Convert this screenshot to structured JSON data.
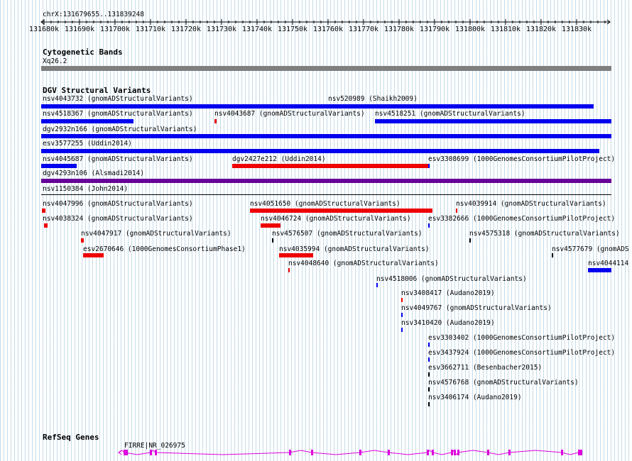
{
  "colors": {
    "blue": "#0000ee",
    "red": "#ee0000",
    "purple": "#660099",
    "gene": "#dd00dd",
    "band": "#7f7f7f"
  },
  "ruler": {
    "range_label": "chrX:131679655..131839248",
    "ticks": [
      "131680k",
      "131690k",
      "131700k",
      "131710k",
      "131720k",
      "131730k",
      "131740k",
      "131750k",
      "131760k",
      "131770k",
      "131780k",
      "131790k",
      "131800k",
      "131810k",
      "131820k",
      "131830k"
    ]
  },
  "tracks": {
    "cyto_title": "Cytogenetic Bands",
    "cyto_band": "Xq26.2",
    "dgv_title": "DGV Structural Variants",
    "refseq_title": "RefSeq Genes"
  },
  "variants": [
    {
      "label": "nsv4043732 (gnomADStructuralVariants)",
      "color": "blue"
    },
    {
      "label": "nsv520989 (Shaikh2009)",
      "color": "blue"
    },
    {
      "label": "nsv4518367 (gnomADStructuralVariants)",
      "color": "blue"
    },
    {
      "label": "nsv4043687 (gnomADStructuralVariants)",
      "color": "red"
    },
    {
      "label": "nsv4518251 (gnomADStructuralVariants)",
      "color": "blue"
    },
    {
      "label": "dgv2932n166 (gnomADStructuralVariants)",
      "color": "blue"
    },
    {
      "label": "esv3577255 (Uddin2014)",
      "color": "blue"
    },
    {
      "label": "nsv4045687 (gnomADStructuralVariants)",
      "color": "blue"
    },
    {
      "label": "dgv2427e212 (Uddin2014)",
      "color": "red"
    },
    {
      "label": "esv3308699 (1000GenomesConsortiumPilotProject)",
      "color": "blue"
    },
    {
      "label": "dgv4293n106 (Alsmadi2014)",
      "color": "purple"
    },
    {
      "label": "nsv1150384 (John2014)",
      "color": "blue"
    },
    {
      "label": "nsv4047996 (gnomADStructuralVariants)",
      "color": "red"
    },
    {
      "label": "nsv4051650 (gnomADStructuralVariants)",
      "color": "red"
    },
    {
      "label": "nsv4039914 (gnomADStructuralVariants)",
      "color": "red"
    },
    {
      "label": "nsv4038324 (gnomADStructuralVariants)",
      "color": "red"
    },
    {
      "label": "nsv4046724 (gnomADStructuralVariants)",
      "color": "red"
    },
    {
      "label": "esv3382666 (1000GenomesConsortiumPilotProject)",
      "color": "blue"
    },
    {
      "label": "nsv4047917 (gnomADStructuralVariants)",
      "color": "red"
    },
    {
      "label": "nsv4576507 (gnomADStructuralVariants)",
      "color": "black"
    },
    {
      "label": "nsv4575318 (gnomADStructuralVariants)",
      "color": "black"
    },
    {
      "label": "esv2670646 (1000GenomesConsortiumPhase1)",
      "color": "red"
    },
    {
      "label": "nsv4035994 (gnomADStructuralVariants)",
      "color": "red"
    },
    {
      "label": "nsv4577679 (gnomADS",
      "color": "black"
    },
    {
      "label": "nsv4048640 (gnomADStructuralVariants)",
      "color": "red"
    },
    {
      "label": "nsv4044114",
      "color": "blue"
    },
    {
      "label": "nsv4518006 (gnomADStructuralVariants)",
      "color": "blue"
    },
    {
      "label": "nsv3408417 (Audano2019)",
      "color": "red"
    },
    {
      "label": "nsv4049767 (gnomADStructuralVariants)",
      "color": "blue"
    },
    {
      "label": "nsv3410420 (Audano2019)",
      "color": "blue"
    },
    {
      "label": "esv3303402 (1000GenomesConsortiumPilotProject)",
      "color": "blue"
    },
    {
      "label": "esv3437924 (1000GenomesConsortiumPilotProject)",
      "color": "blue"
    },
    {
      "label": "esv3662711 (Besenbacher2015)",
      "color": "black"
    },
    {
      "label": "nsv4576768 (gnomADStructuralVariants)",
      "color": "black"
    },
    {
      "label": "nsv3406174 (Audano2019)",
      "color": "black"
    }
  ],
  "gene": {
    "label": "FIRRE|NR_026975"
  }
}
